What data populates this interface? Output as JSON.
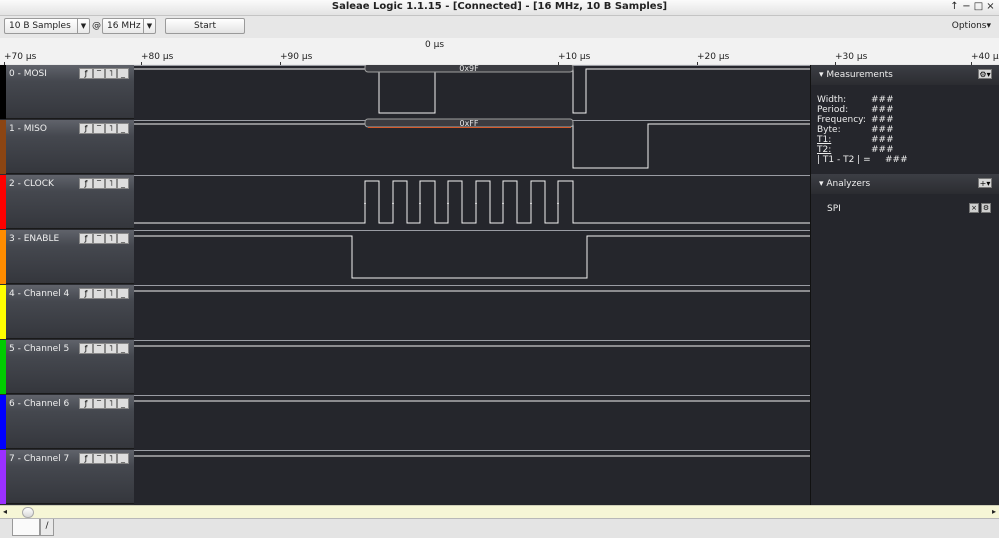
{
  "window": {
    "title": "Saleae Logic 1.1.15 - [Connected] - [16 MHz, 10 B Samples]",
    "controls": [
      "↑",
      "−",
      "□",
      "×"
    ]
  },
  "toolbar": {
    "samples": "10 B Samples",
    "at": "@",
    "rate": "16 MHz",
    "start_label": "Start",
    "options_label": "Options▾"
  },
  "ruler": {
    "zero_label": "0 µs",
    "ticks": [
      "+70 µs",
      "+80 µs",
      "+90 µs",
      "+10 µs",
      "+20 µs",
      "+30 µs",
      "+40 µs"
    ]
  },
  "channels": [
    {
      "label": "0 - MOSI",
      "color": "#000000"
    },
    {
      "label": "1 - MISO",
      "color": "#8b4513"
    },
    {
      "label": "2 - CLOCK",
      "color": "#ff0000"
    },
    {
      "label": "3 - ENABLE",
      "color": "#ff8c00"
    },
    {
      "label": "4 - Channel 4",
      "color": "#ffff00"
    },
    {
      "label": "5 - Channel 5",
      "color": "#00cc00"
    },
    {
      "label": "6 - Channel 6",
      "color": "#0000ff"
    },
    {
      "label": "7 - Channel 7",
      "color": "#9b30ff"
    }
  ],
  "decoded": {
    "mosi": "0x9F",
    "miso": "0xFF"
  },
  "measurements": {
    "title": "Measurements",
    "rows": [
      {
        "label": "Width:",
        "value": "###"
      },
      {
        "label": "Period:",
        "value": "###"
      },
      {
        "label": "Frequency:",
        "value": "###"
      },
      {
        "label": "Byte:",
        "value": "###"
      },
      {
        "label": "T1:",
        "value": "###"
      },
      {
        "label": "T2:",
        "value": "###"
      },
      {
        "label": "| T1 - T2 | =",
        "value": "###"
      }
    ]
  },
  "analyzers": {
    "title": "Analyzers",
    "items": [
      "SPI"
    ]
  },
  "bottom_tabs": [
    "",
    "/"
  ]
}
